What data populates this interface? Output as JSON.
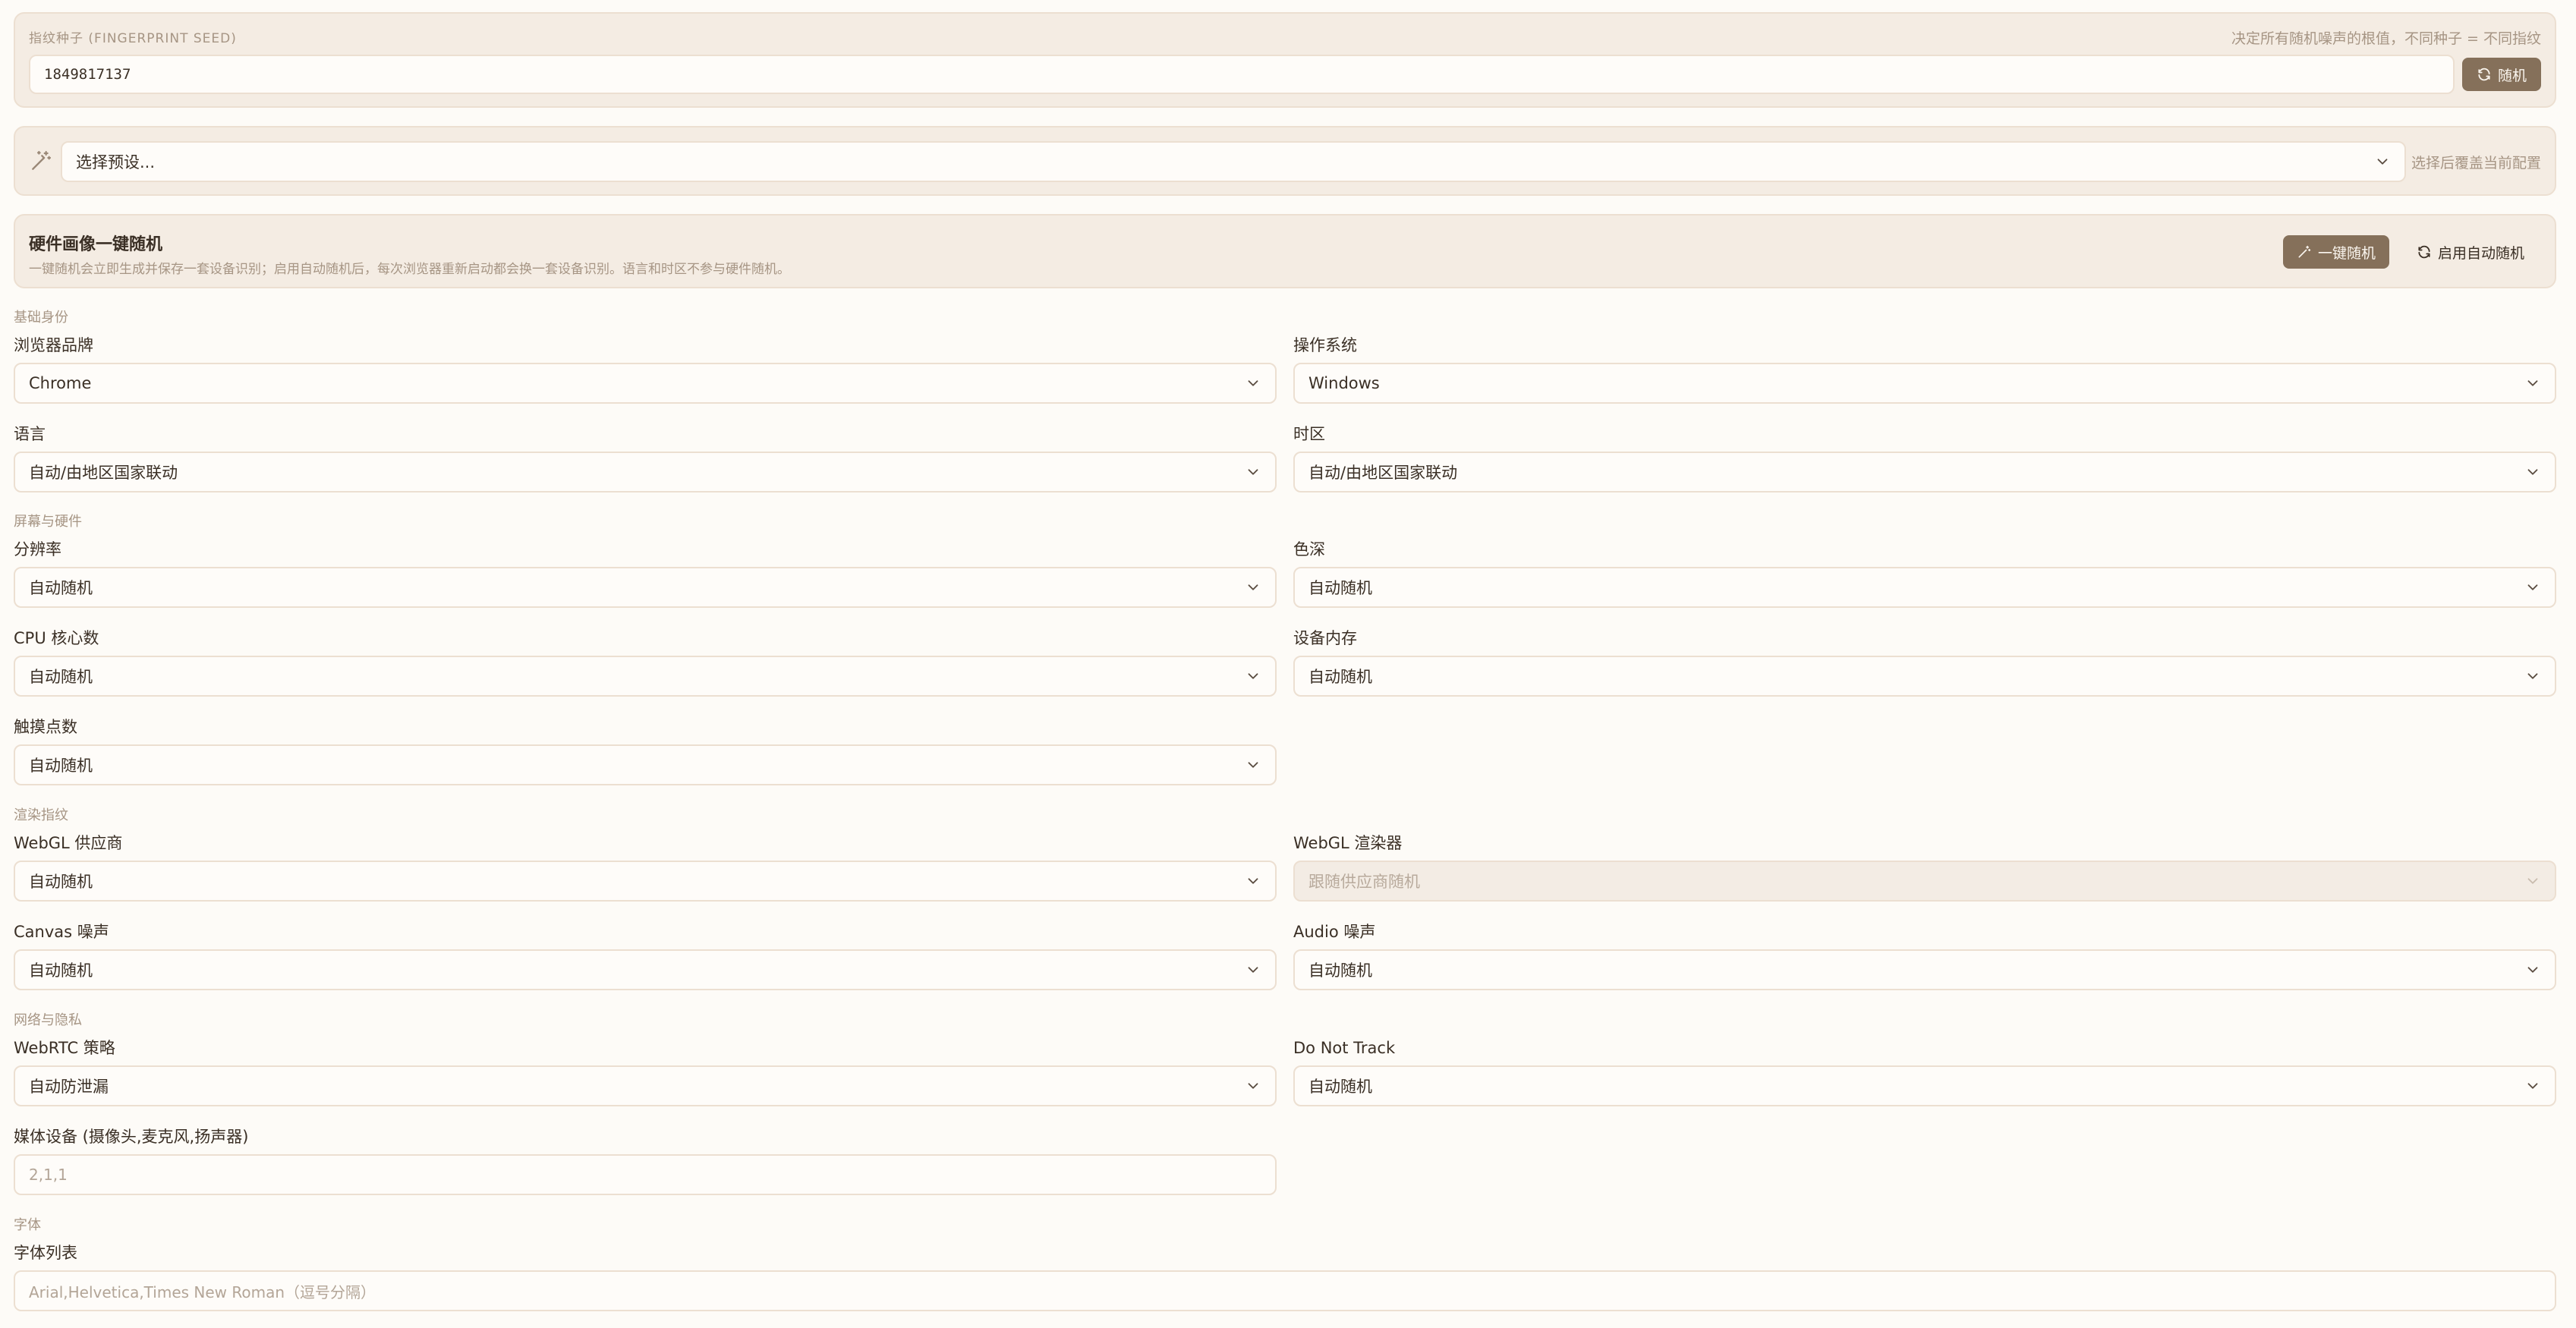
{
  "seed": {
    "label": "指纹种子 (FINGERPRINT SEED)",
    "hint": "决定所有随机噪声的根值，不同种子 = 不同指纹",
    "value": "1849817137",
    "random_button": "随机",
    "random_icon": "refresh-icon"
  },
  "preset": {
    "icon": "magic-wand-icon",
    "placeholder": "选择预设...",
    "hint": "选择后覆盖当前配置"
  },
  "hardware": {
    "title": "硬件画像一键随机",
    "description": "一键随机会立即生成并保存一套设备识别；启用自动随机后，每次浏览器重新启动都会换一套设备识别。语言和时区不参与硬件随机。",
    "random_button": "一键随机",
    "auto_button": "启用自动随机"
  },
  "sections": {
    "basic": "基础身份",
    "screen": "屏幕与硬件",
    "render": "渲染指纹",
    "network": "网络与隐私",
    "fonts": "字体"
  },
  "fields": {
    "browser": {
      "label": "浏览器品牌",
      "value": "Chrome"
    },
    "os": {
      "label": "操作系统",
      "value": "Windows"
    },
    "language": {
      "label": "语言",
      "value": "自动/由地区国家联动"
    },
    "timezone": {
      "label": "时区",
      "value": "自动/由地区国家联动"
    },
    "resolution": {
      "label": "分辨率",
      "value": "自动随机"
    },
    "color_depth": {
      "label": "色深",
      "value": "自动随机"
    },
    "cpu": {
      "label": "CPU 核心数",
      "value": "自动随机"
    },
    "memory": {
      "label": "设备内存",
      "value": "自动随机"
    },
    "touch": {
      "label": "触摸点数",
      "value": "自动随机"
    },
    "webgl_vendor": {
      "label": "WebGL 供应商",
      "value": "自动随机"
    },
    "webgl_renderer": {
      "label": "WebGL 渲染器",
      "value": "跟随供应商随机"
    },
    "canvas": {
      "label": "Canvas 噪声",
      "value": "自动随机"
    },
    "audio": {
      "label": "Audio 噪声",
      "value": "自动随机"
    },
    "webrtc": {
      "label": "WebRTC 策略",
      "value": "自动防泄漏"
    },
    "dnt": {
      "label": "Do Not Track",
      "value": "自动随机"
    },
    "media": {
      "label": "媒体设备 (摄像头,麦克风,扬声器)",
      "placeholder": "2,1,1"
    },
    "font_list": {
      "label": "字体列表",
      "placeholder": "Arial,Helvetica,Times New Roman（逗号分隔）"
    }
  },
  "colors": {
    "accent": "#85705a",
    "panel": "#f4ece3",
    "background": "#fdfbf7"
  }
}
